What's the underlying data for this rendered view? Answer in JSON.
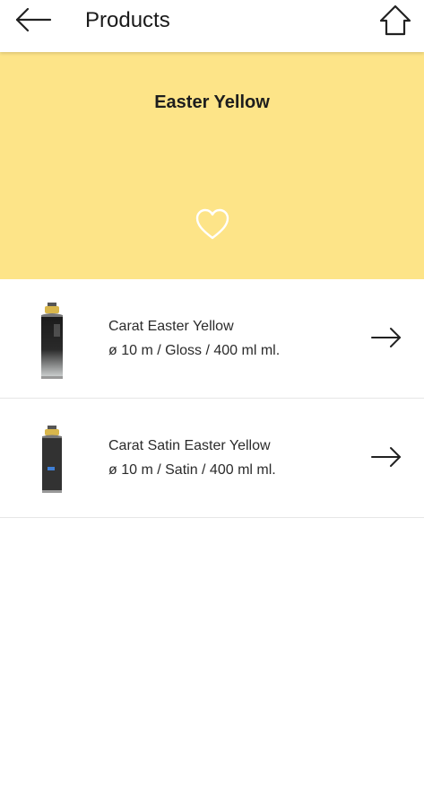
{
  "header": {
    "title": "Products",
    "back_icon": "arrow-left-icon",
    "home_icon": "home-icon"
  },
  "banner": {
    "color_name": "Easter Yellow",
    "background_color": "#fde488",
    "favorite_icon": "heart-outline-icon"
  },
  "products": [
    {
      "name": "Carat Easter Yellow",
      "spec": "ø 10 m / Gloss / 400 ml ml.",
      "image_icon": "spray-can-icon",
      "action_icon": "arrow-right-icon"
    },
    {
      "name": "Carat Satin Easter Yellow",
      "spec": "ø 10 m / Satin / 400 ml ml.",
      "image_icon": "spray-can-icon",
      "action_icon": "arrow-right-icon"
    }
  ]
}
